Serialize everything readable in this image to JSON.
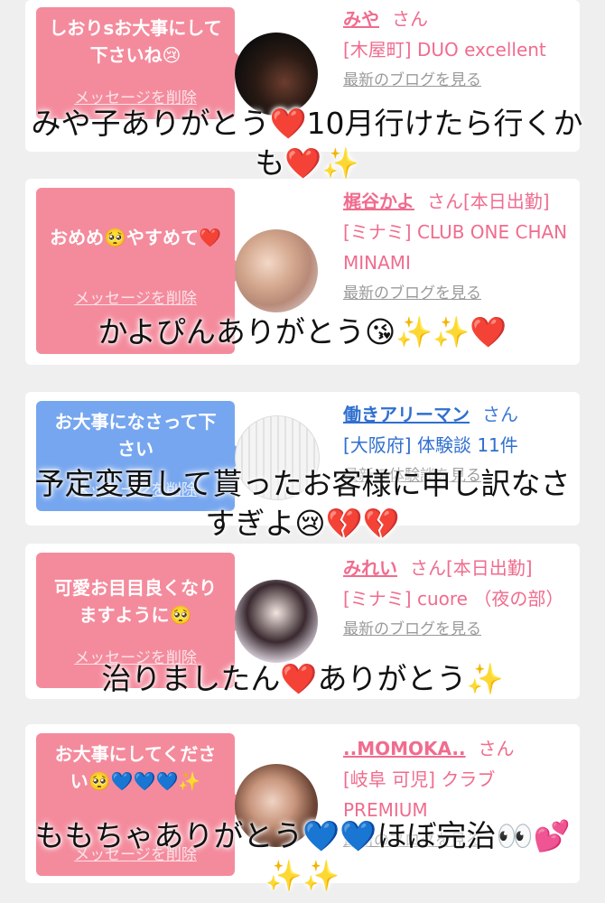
{
  "cards": [
    {
      "message": "しおりsお大事にして下さいね😢",
      "delete_label": "メッセージを削除",
      "name": "みや",
      "san": "さん",
      "location": "[木屋町] DUO excellent",
      "blog_label": "最新のブログを見る",
      "overlay": "みや子ありがとう❤️10月行けたら行くかも❤️✨"
    },
    {
      "message": "おめめ🥺やすめて❤️",
      "delete_label": "メッセージを削除",
      "name": "梶谷かよ",
      "san": "さん[本日出勤]",
      "location": "[ミナミ] CLUB ONE CHAN MINAMI",
      "blog_label": "最新のブログを見る",
      "overlay": "かよぴんありがとう😘✨✨❤️"
    },
    {
      "message": "お大事になさって下さい",
      "delete_label": "メッセージを削除",
      "name": "働きアリーマン",
      "san": "さん",
      "location": "[大阪府] 体験談 11件",
      "blog_label": "最新の体験談を見る",
      "overlay": "予定変更して貰ったお客様に申し訳なさすぎよ😢💔💔"
    },
    {
      "message": "可愛お目目良くなりますように🥺",
      "delete_label": "メッセージを削除",
      "name": "みれい",
      "san": "さん[本日出勤]",
      "location": "[ミナミ] cuore （夜の部）",
      "blog_label": "最新のブログを見る",
      "overlay": "治りましたん❤️ありがとう✨"
    },
    {
      "message": "お大事にしてください🥺💙💙💙✨",
      "delete_label": "メッセージを削除",
      "name": "..MOMOKA..",
      "san": "さん",
      "location": "[岐阜 可児] クラブ PREMIUM",
      "blog_label": "最新のブログを見る",
      "overlay": "ももちゃありがとう💙💙ほぼ完治👀💕✨✨"
    }
  ],
  "colors": {
    "pink_bubble": "#f48b9d",
    "blue_bubble": "#76a6ef",
    "pink_text": "#f06c8e",
    "blue_text": "#2f6fcf"
  }
}
